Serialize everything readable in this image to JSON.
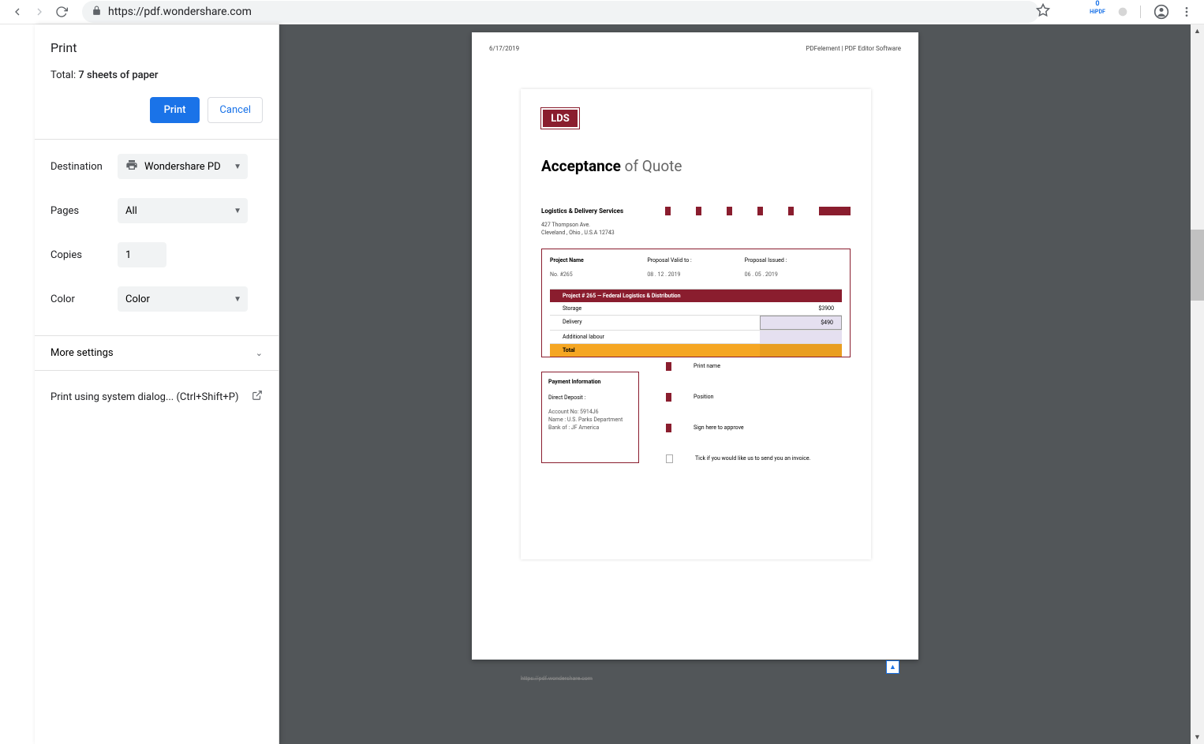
{
  "browser": {
    "url": "https://pdf.wondershare.com"
  },
  "print": {
    "title": "Print",
    "total_prefix": "Total: ",
    "total_value": "7 sheets of paper",
    "print_btn": "Print",
    "cancel_btn": "Cancel",
    "destination_label": "Destination",
    "destination_value": "Wondershare PDFel",
    "pages_label": "Pages",
    "pages_value": "All",
    "copies_label": "Copies",
    "copies_value": "1",
    "color_label": "Color",
    "color_value": "Color",
    "more_settings": "More settings",
    "system_dialog": "Print using system dialog... (Ctrl+Shift+P)"
  },
  "page": {
    "header_left": "6/17/2019",
    "header_right": "PDFelement | PDF Editor Software",
    "footer_url": "https://pdf.wondershare.com"
  },
  "doc": {
    "logo": "LDS",
    "title_bold": "Acceptance",
    "title_light": " of Quote",
    "company": "Logistics & Delivery Services",
    "addr1": "427 Thompson Ave.",
    "addr2": "Cleveland , Ohio , U.S.A 12743",
    "col1_label": "Project Name",
    "col1_value": "No. #265",
    "col2_label": "Proposal Valid to :",
    "col2_value": "08 . 12 . 2019",
    "col3_label": "Proposal Issued :",
    "col3_value": "06 . 05 . 2019",
    "table_header": "Project # 265 — Federal Logistics & Distribution",
    "row1_label": "Storage",
    "row1_value": "$3900",
    "row2_label": "Delivery",
    "row2_value": "$490",
    "row3_label": "Additional labour",
    "row_total": "Total",
    "payment_title": "Payment Information",
    "payment_sub": "Direct Deposit :",
    "payment_l1": "Account No: 5914J6",
    "payment_l2": "Name : U.S. Parks Department",
    "payment_l3": "Bank of : JF America",
    "sign1": "Print name",
    "sign2": "Position",
    "sign3": "Sign here to approve",
    "sign4": "Tick if you would like us to send you an invoice."
  }
}
